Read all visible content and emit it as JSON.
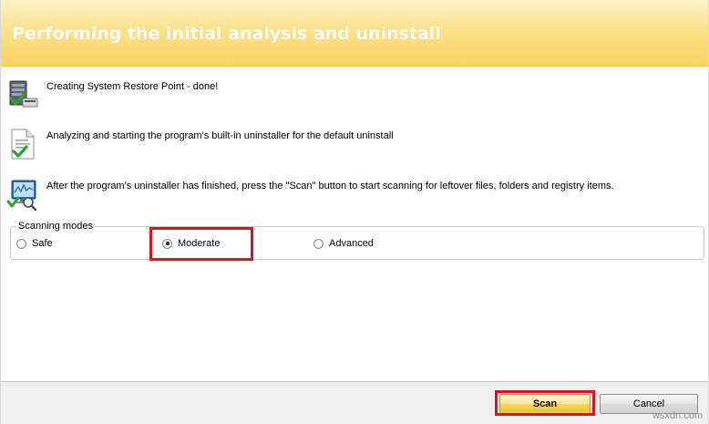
{
  "header": {
    "title": "Performing the initial analysis and uninstall",
    "gradient_top": "#fdf3c8",
    "gradient_bottom": "#fbd45e"
  },
  "steps": [
    {
      "icon": "restore-point-done-icon",
      "text": "Creating System Restore Point - done!"
    },
    {
      "icon": "uninstaller-document-check-icon",
      "text": "Analyzing and starting the program's built-in uninstaller for the default uninstall"
    },
    {
      "icon": "scan-monitor-magnifier-icon",
      "text": "After the program's uninstaller has finished, press the \"Scan\" button to start scanning for leftover files, folders and registry items."
    }
  ],
  "scanning_modes": {
    "legend": "Scanning modes",
    "options": [
      {
        "label": "Safe",
        "checked": false
      },
      {
        "label": "Moderate",
        "checked": true
      },
      {
        "label": "Advanced",
        "checked": false
      }
    ]
  },
  "footer": {
    "scan_label": "Scan",
    "cancel_label": "Cancel"
  },
  "watermark": "wsxdn.com",
  "colors": {
    "highlight": "#e0101f",
    "header_text": "#ffffff"
  }
}
